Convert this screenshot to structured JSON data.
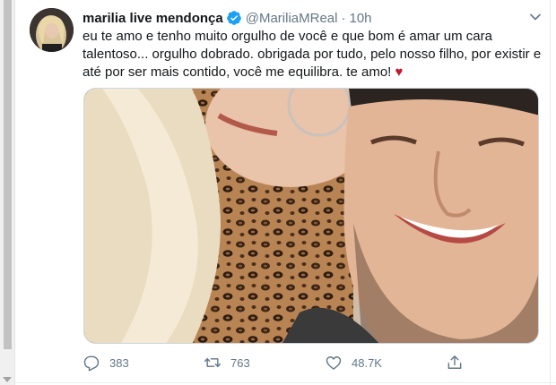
{
  "tweet": {
    "author": {
      "display_name": "marilia live mendonça",
      "handle": "@MariliaMReal",
      "verified_icon": "verified-badge-icon"
    },
    "separator": "·",
    "timestamp": "10h",
    "text": "eu te amo e tenho muito orgulho de você e que bom é amar um cara talentoso... orgulho dobrado. obrigada por tudo, pelo nosso filho, por existir e até por ser mais contido, você me equilibra. te amo!",
    "emoji": "♥",
    "actions": {
      "replies": "383",
      "retweets": "763",
      "likes": "48.7K"
    },
    "colors": {
      "text": "#14171a",
      "muted": "#657786",
      "verified": "#1da1f2",
      "heart": "#be1931"
    }
  }
}
